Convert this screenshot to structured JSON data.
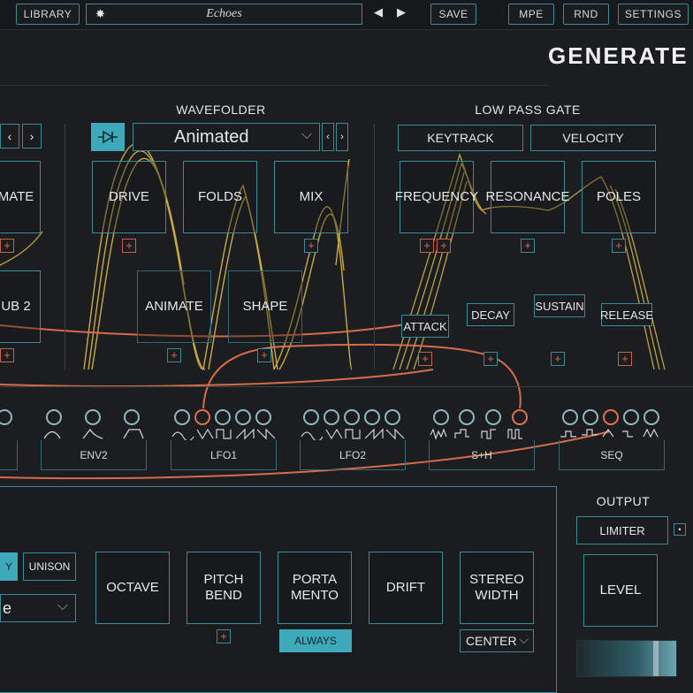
{
  "topbar": {
    "library_label": "LIBRARY",
    "preset_name": "Echoes",
    "prev_arrow": "◀",
    "next_arrow": "▶",
    "save_label": "SAVE",
    "mpe_label": "MPE",
    "rnd_label": "RND",
    "settings_label": "SETTINGS"
  },
  "header": {
    "title": "GENERATE"
  },
  "wavefolder": {
    "title": "WAVEFOLDER",
    "mode": "Animated",
    "knobs": {
      "drive": "DRIVE",
      "folds": "FOLDS",
      "mix": "MIX",
      "animate": "ANIMATE",
      "shape": "SHAPE"
    }
  },
  "left_partial": {
    "knob1": "MATE",
    "knob2": "UB 2"
  },
  "lpg": {
    "title": "LOW PASS GATE",
    "keytrack": "KEYTRACK",
    "velocity": "VELOCITY",
    "knobs": {
      "frequency": "FREQUENCY",
      "resonance": "RESONANCE",
      "poles": "POLES"
    },
    "envelope": {
      "attack": "ATTACK",
      "decay": "DECAY",
      "sustain": "SUSTAIN",
      "release": "RELEASE"
    }
  },
  "mod_sources": {
    "env2": "ENV2",
    "lfo1": "LFO1",
    "lfo2": "LFO2",
    "sh": "S+H",
    "seq": "SEQ"
  },
  "voice": {
    "mode_active": "Y",
    "unison": "UNISON",
    "dropdown_value": "e",
    "octave": "OCTAVE",
    "pitch_bend": "PITCH\nBEND",
    "portamento": "PORTA\nMENTO",
    "portamento_mode": "ALWAYS",
    "drift": "DRIFT",
    "stereo_width": "STEREO\nWIDTH",
    "stereo_mode": "CENTER"
  },
  "output": {
    "title": "OUTPUT",
    "limiter": "LIMITER",
    "level": "LEVEL"
  },
  "icons": {
    "plus": "+",
    "chevron": "⌵"
  },
  "colors": {
    "accent_teal": "#3c8a96",
    "mod_orange": "#e0714d",
    "wave_yellow": "#e8c34a",
    "background": "#1b1d20"
  }
}
